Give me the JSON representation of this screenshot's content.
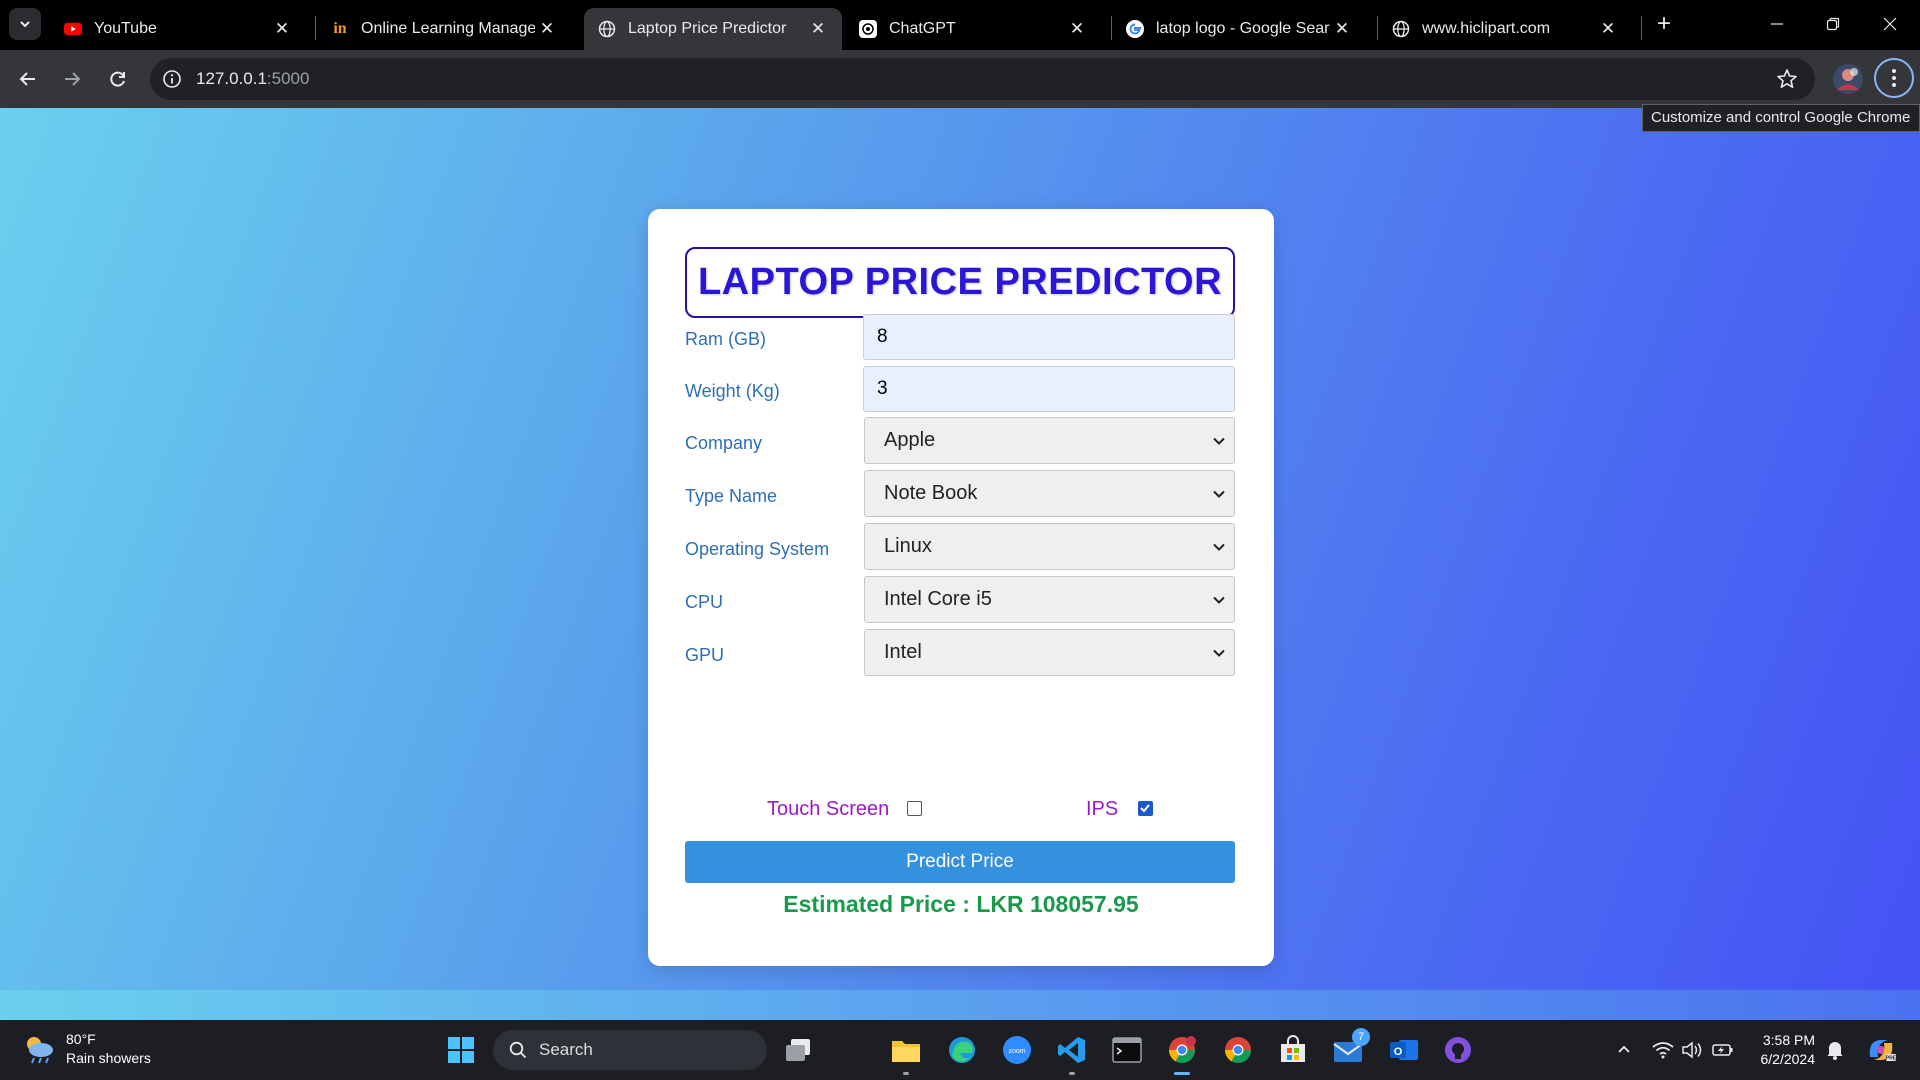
{
  "browser": {
    "tabs": [
      {
        "title": "YouTube",
        "favicon": "youtube-icon",
        "active": false
      },
      {
        "title": "Online Learning Managem",
        "favicon": "lms-icon",
        "active": false
      },
      {
        "title": "Laptop Price Predictor",
        "favicon": "globe-icon",
        "active": true
      },
      {
        "title": "ChatGPT",
        "favicon": "chatgpt-icon",
        "active": false
      },
      {
        "title": "latop logo - Google Search",
        "favicon": "google-icon",
        "active": false
      },
      {
        "title": "www.hiclipart.com",
        "favicon": "globe-icon",
        "active": false
      }
    ],
    "url_host": "127.0.0.1",
    "url_port": ":5000",
    "tooltip": "Customize and control Google Chrome"
  },
  "app": {
    "title": "LAPTOP PRICE PREDICTOR",
    "fields": {
      "ram": {
        "label": "Ram (GB)",
        "value": "8"
      },
      "weight": {
        "label": "Weight (Kg)",
        "value": "3"
      },
      "company": {
        "label": "Company",
        "value": "Apple"
      },
      "type_name": {
        "label": "Type Name",
        "value": "Note Book"
      },
      "os": {
        "label": "Operating System",
        "value": "Linux"
      },
      "cpu": {
        "label": "CPU",
        "value": "Intel Core i5"
      },
      "gpu": {
        "label": "GPU",
        "value": "Intel"
      }
    },
    "touch_screen": {
      "label": "Touch Screen",
      "checked": false
    },
    "ips": {
      "label": "IPS",
      "checked": true
    },
    "predict_button": "Predict Price",
    "result": "Estimated Price : LKR 108057.95"
  },
  "taskbar": {
    "weather_temp": "80°F",
    "weather_desc": "Rain showers",
    "search_label": "Search",
    "mail_badge": "7",
    "time": "3:58 PM",
    "date": "6/2/2024"
  },
  "colors": {
    "title": "#2b16d8",
    "label": "#2d6fb6",
    "checkbox_label": "#9a19c8",
    "button": "#3491de",
    "result": "#189a4a"
  }
}
